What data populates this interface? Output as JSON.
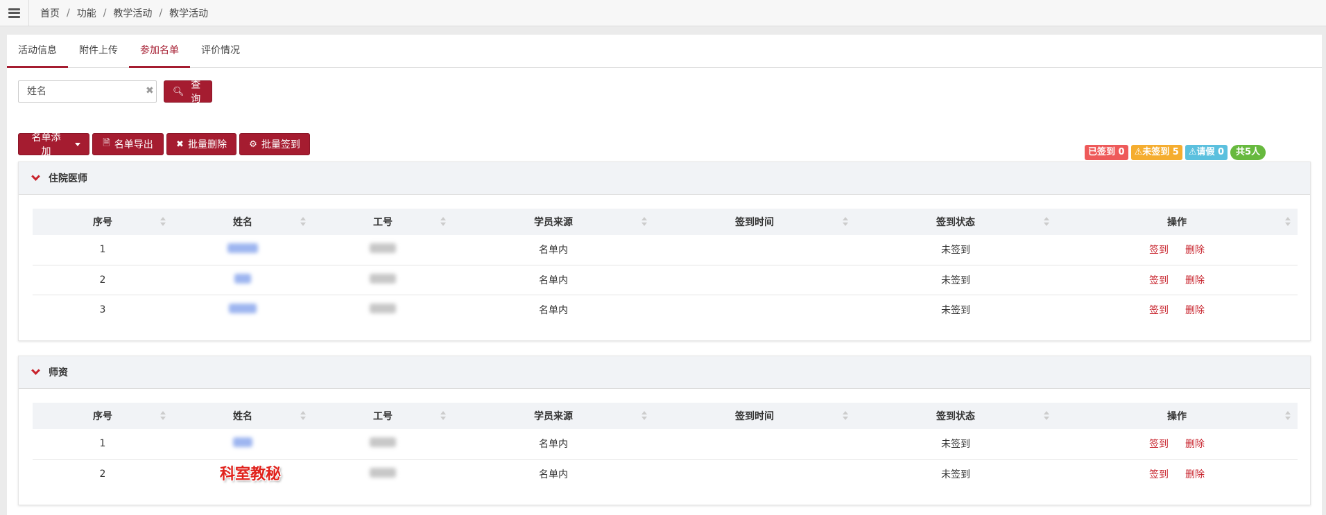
{
  "breadcrumb": [
    "首页",
    "功能",
    "教学活动",
    "教学活动"
  ],
  "tabs": [
    {
      "label": "活动信息",
      "active": false
    },
    {
      "label": "附件上传",
      "active": false
    },
    {
      "label": "参加名单",
      "active": true
    },
    {
      "label": "评价情况",
      "active": false
    }
  ],
  "search": {
    "placeholder": "姓名",
    "value": "",
    "button_label": "查询"
  },
  "actions": {
    "add_label": "名单添加",
    "export_label": "名单导出",
    "batch_delete_label": "批量删除",
    "batch_sign_label": "批量签到"
  },
  "stats": {
    "signed": "已签到 0",
    "unsigned": "⚠未签到 5",
    "leave": "⚠请假 0",
    "total": "共5人"
  },
  "columns": [
    "序号",
    "姓名",
    "工号",
    "学员来源",
    "签到时间",
    "签到状态",
    "操作"
  ],
  "groups": [
    {
      "title": "住院医师",
      "rows": [
        {
          "no": "1",
          "source": "名单内",
          "time": "",
          "status": "未签到"
        },
        {
          "no": "2",
          "source": "名单内",
          "time": "",
          "status": "未签到"
        },
        {
          "no": "3",
          "source": "名单内",
          "time": "",
          "status": "未签到"
        }
      ]
    },
    {
      "title": "师资",
      "rows": [
        {
          "no": "1",
          "source": "名单内",
          "time": "",
          "status": "未签到"
        },
        {
          "no": "2",
          "source": "名单内",
          "time": "",
          "status": "未签到"
        }
      ]
    }
  ],
  "ops": {
    "sign": "签到",
    "delete": "删除"
  },
  "watermark": "科室教秘",
  "colors": {
    "accent": "#a51c30",
    "link": "#c8232c"
  }
}
